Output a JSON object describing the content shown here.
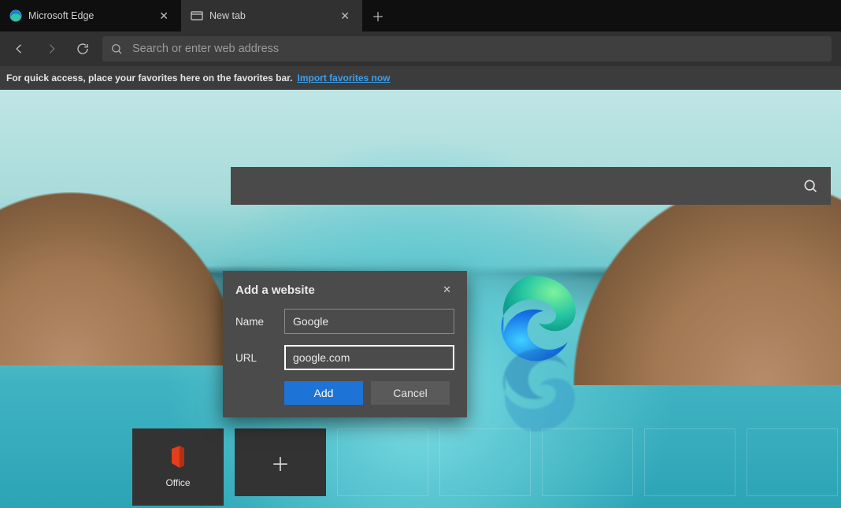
{
  "tabs": [
    {
      "title": "Microsoft Edge",
      "active": false
    },
    {
      "title": "New tab",
      "active": true
    }
  ],
  "toolbar": {
    "address_placeholder": "Search or enter web address"
  },
  "favorites_bar": {
    "hint": "For quick access, place your favorites here on the favorites bar.",
    "import_link": "Import favorites now"
  },
  "dialog": {
    "title": "Add a website",
    "name_label": "Name",
    "name_value": "Google",
    "url_label": "URL",
    "url_value": "google.com",
    "add_label": "Add",
    "cancel_label": "Cancel"
  },
  "tiles": [
    {
      "label": "Office",
      "type": "app"
    },
    {
      "label": "",
      "type": "add"
    },
    {
      "label": "",
      "type": "placeholder"
    },
    {
      "label": "",
      "type": "placeholder"
    },
    {
      "label": "",
      "type": "placeholder"
    },
    {
      "label": "",
      "type": "placeholder"
    },
    {
      "label": "",
      "type": "placeholder"
    }
  ]
}
